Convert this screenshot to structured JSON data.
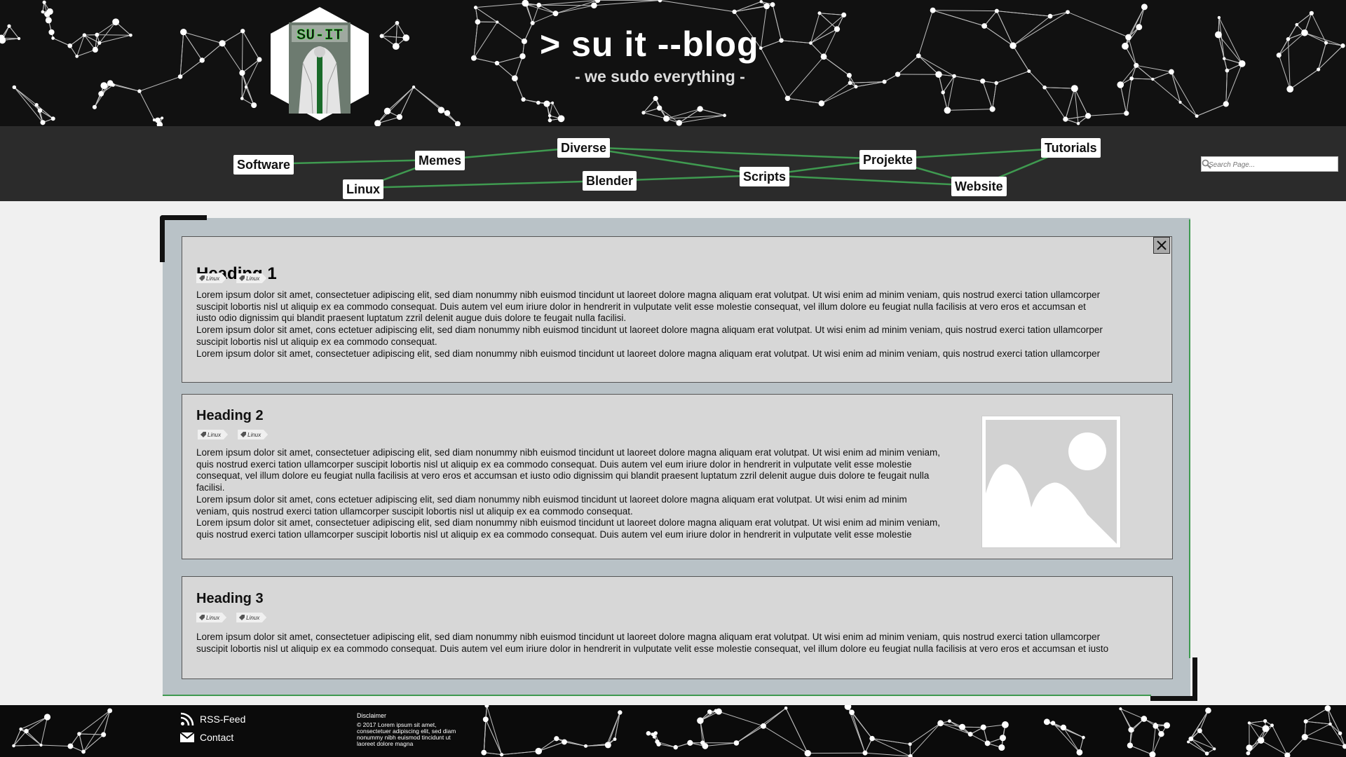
{
  "header": {
    "title": "> su it --blog",
    "subtitle": "- we sudo everything -",
    "logo_text": "SU-IT"
  },
  "nav": {
    "items": [
      "Software",
      "Linux",
      "Memes",
      "Diverse",
      "Blender",
      "Scripts",
      "Projekte",
      "Website",
      "Tutorials"
    ],
    "search_placeholder": "Search Page..."
  },
  "posts": [
    {
      "heading": "Heading 1",
      "tags": [
        "Linux",
        "Linux"
      ],
      "lines": [
        "Lorem ipsum dolor sit amet, consectetuer adipiscing elit, sed diam nonummy nibh euismod tincidunt ut laoreet dolore magna aliquam erat volutpat. Ut wisi enim ad minim veniam, quis nostrud exerci tation ullamcorper",
        "suscipit lobortis nisl ut aliquip ex ea commodo consequat. Duis autem vel eum iriure dolor in hendrerit in vulputate velit esse molestie consequat, vel illum dolore eu feugiat nulla facilisis at vero eros et accumsan et",
        "iusto odio dignissim qui blandit praesent luptatum zzril delenit augue duis dolore te feugait nulla facilisi.",
        "Lorem ipsum dolor sit amet, cons ectetuer adipiscing elit, sed diam nonummy nibh euismod tincidunt ut laoreet dolore magna aliquam erat volutpat. Ut wisi enim ad minim veniam, quis nostrud exerci tation ullamcorper",
        "suscipit lobortis nisl ut aliquip ex ea commodo consequat.",
        "Lorem ipsum dolor sit amet, consectetuer adipiscing elit, sed diam nonummy nibh euismod tincidunt ut laoreet dolore magna aliquam erat volutpat. Ut wisi enim ad minim veniam, quis nostrud exerci tation ullamcorper"
      ]
    },
    {
      "heading": "Heading 2",
      "tags": [
        "Linux",
        "Linux"
      ],
      "lines": [
        "Lorem ipsum dolor sit amet, consectetuer adipiscing elit, sed diam nonummy nibh euismod tincidunt ut laoreet dolore magna aliquam erat volutpat. Ut wisi enim ad minim veniam,",
        "quis nostrud exerci tation ullamcorper suscipit lobortis nisl ut aliquip ex ea commodo consequat. Duis autem vel eum iriure dolor in hendrerit in vulputate velit esse molestie",
        "consequat, vel illum dolore eu feugiat nulla facilisis at vero eros et accumsan et iusto odio dignissim qui blandit praesent luptatum zzril delenit augue duis dolore te feugait nulla",
        "facilisi.",
        "Lorem ipsum dolor sit amet, cons ectetuer adipiscing elit, sed diam nonummy nibh euismod tincidunt ut laoreet dolore magna aliquam erat volutpat. Ut wisi enim ad minim",
        "veniam, quis nostrud exerci tation ullamcorper suscipit lobortis nisl ut aliquip ex ea commodo consequat.",
        "Lorem ipsum dolor sit amet, consectetuer adipiscing elit, sed diam nonummy nibh euismod tincidunt ut laoreet dolore magna aliquam erat volutpat. Ut wisi enim ad minim veniam,",
        "quis nostrud exerci tation ullamcorper suscipit lobortis nisl ut aliquip ex ea commodo consequat. Duis autem vel eum iriure dolor in hendrerit in vulputate velit esse molestie"
      ]
    },
    {
      "heading": "Heading 3",
      "tags": [
        "Linux",
        "Linux"
      ],
      "lines": [
        "Lorem ipsum dolor sit amet, consectetuer adipiscing elit, sed diam nonummy nibh euismod tincidunt ut laoreet dolore magna aliquam erat volutpat. Ut wisi enim ad minim veniam, quis nostrud exerci tation ullamcorper",
        "suscipit lobortis nisl ut aliquip ex ea commodo consequat. Duis autem vel eum iriure dolor in hendrerit in vulputate velit esse molestie consequat, vel illum dolore eu feugiat nulla facilisis at vero eros et accumsan et iusto"
      ]
    }
  ],
  "footer": {
    "rss_label": "RSS-Feed",
    "contact_label": "Contact",
    "disclaimer_title": "Disclaimer",
    "disclaimer_text": "© 2017 Lorem ipsum sit amet, consectetuer adipiscing elit, sed diam nonummy nibh euismod tincidunt ut laoreet dolore magna"
  },
  "colors": {
    "header_bg": "#111111",
    "nav_bg": "#2b2b2b",
    "nav_line": "#3f9a50",
    "panel_bg": "#b9c2c7",
    "post_bg": "#d7d7d7",
    "accent_green": "#3f9a50"
  },
  "icons": {
    "close": "close-icon",
    "search": "search-icon",
    "rss": "rss-icon",
    "contact": "mail-icon",
    "tag": "tag-icon",
    "image": "image-placeholder-icon"
  }
}
